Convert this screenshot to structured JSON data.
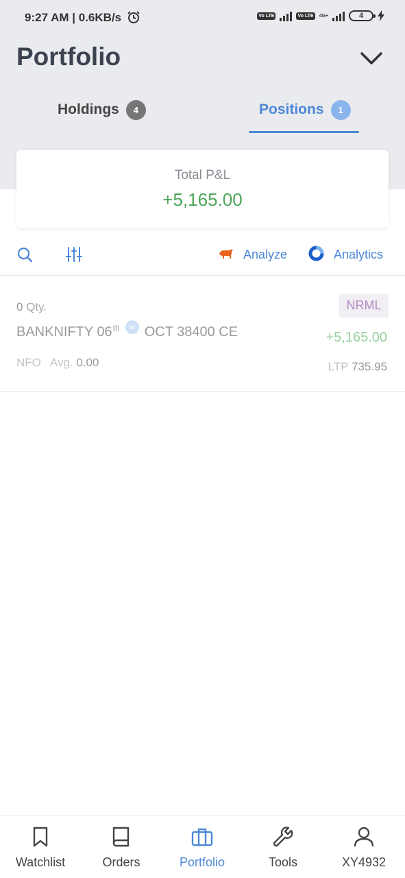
{
  "status_bar": {
    "time": "9:27 AM | 0.6KB/s",
    "sim1_tag": "Vo LTE",
    "sim2_tag": "Vo LTE",
    "network_label": "4G+",
    "battery_level": "4"
  },
  "header": {
    "title": "Portfolio"
  },
  "tabs": [
    {
      "label": "Holdings",
      "count": "4",
      "selected": false
    },
    {
      "label": "Positions",
      "count": "1",
      "selected": true
    }
  ],
  "summary": {
    "label": "Total P&L",
    "value": "+5,165.00"
  },
  "toolbar": {
    "analyze_label": "Analyze",
    "analytics_label": "Analytics"
  },
  "position": {
    "qty_value": "0",
    "qty_label": "Qty.",
    "symbol_prefix": "BANKNIFTY 06",
    "symbol_suffix_sup": "th",
    "weekly_badge": "W",
    "symbol_rest": "OCT 38400 CE",
    "exchange": "NFO",
    "avg_label": "Avg.",
    "avg_value": "0.00",
    "product": "NRML",
    "pnl": "+5,165.00",
    "ltp_label": "LTP",
    "ltp_value": "735.95"
  },
  "bottom_nav": [
    {
      "label": "Watchlist",
      "icon": "bookmark-icon",
      "active": false
    },
    {
      "label": "Orders",
      "icon": "book-icon",
      "active": false
    },
    {
      "label": "Portfolio",
      "icon": "briefcase-icon",
      "active": true
    },
    {
      "label": "Tools",
      "icon": "wrench-icon",
      "active": false
    },
    {
      "label": "XY4932",
      "icon": "user-icon",
      "active": false
    }
  ],
  "colors": {
    "accent": "#4d88d7",
    "profit": "#4ca65a",
    "header_bg": "#e9ebee"
  }
}
